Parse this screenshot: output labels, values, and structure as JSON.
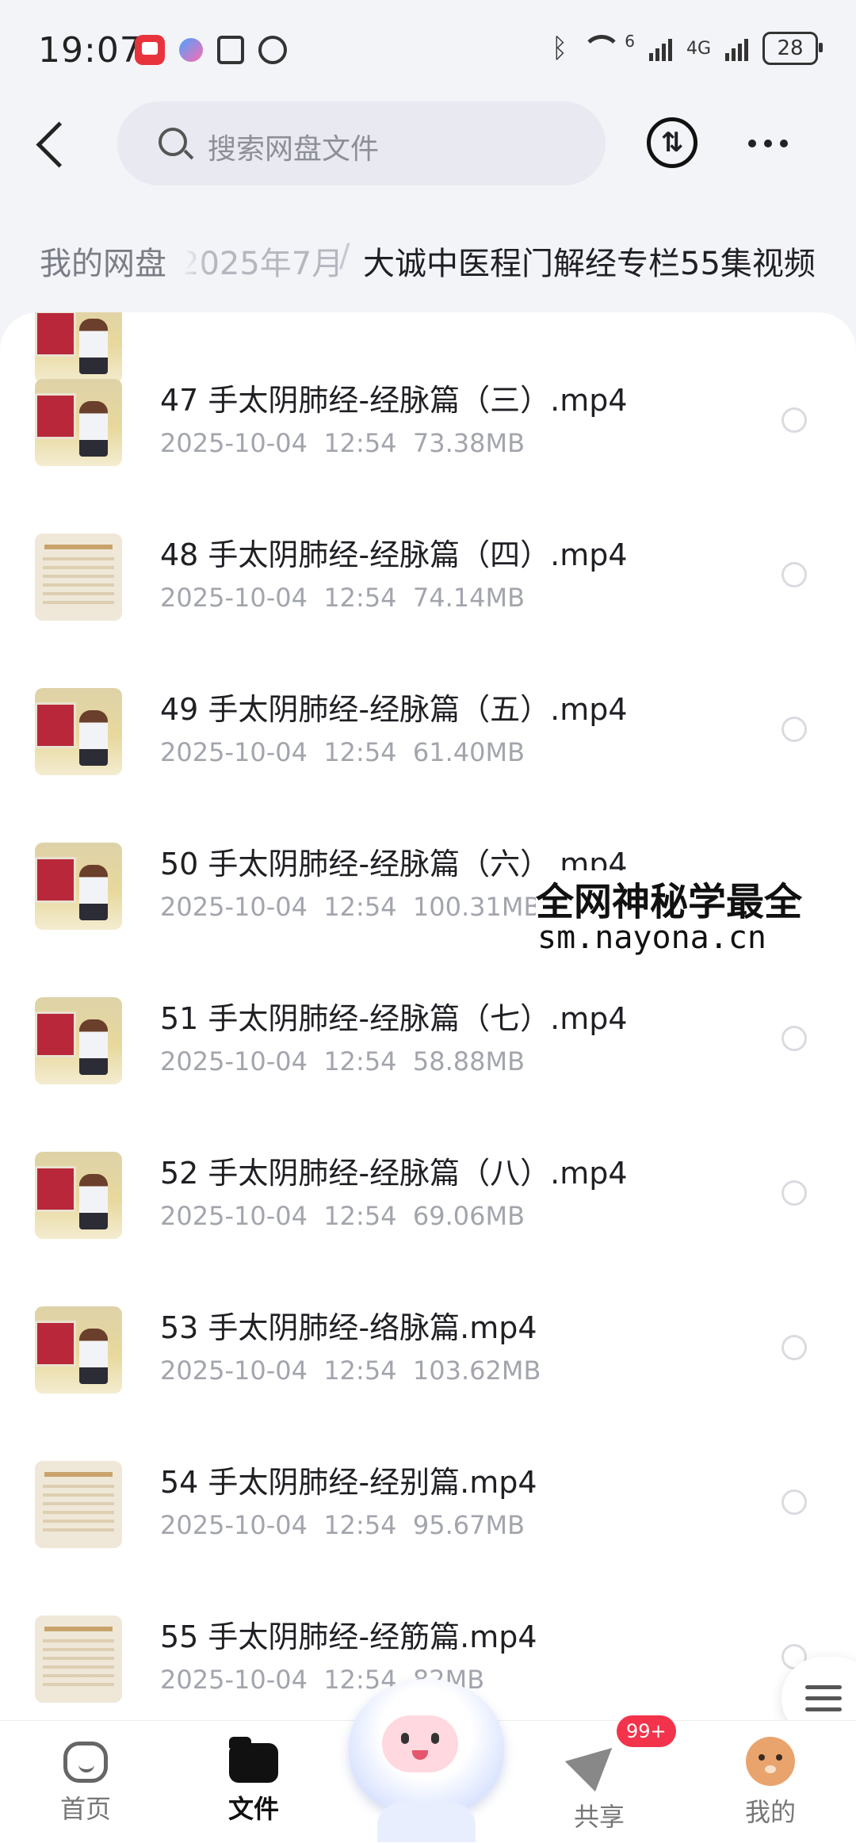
{
  "status_bar": {
    "time": "19:07",
    "network_sup": "6",
    "network_type": "4G",
    "battery": "28",
    "icons": [
      "red-app-icon",
      "cloud-icon",
      "nfc-icon",
      "alarm-icon",
      "bluetooth-icon",
      "wifi-icon",
      "signal-icon",
      "signal-icon",
      "battery-icon"
    ]
  },
  "header": {
    "search_placeholder": "搜索网盘文件",
    "icons": [
      "back-icon",
      "search-icon",
      "transfer-icon",
      "more-icon"
    ]
  },
  "breadcrumb": {
    "root": "我的网盘",
    "middle": "2025年7月",
    "separator": "/",
    "current": "大诚中医程门解经专栏55集视频"
  },
  "files": [
    {
      "name": "47 手太阴肺经-经脉篇（三）.mp4",
      "date": "2025-10-04",
      "time": "12:54",
      "size": "73.38MB",
      "thumb": "video"
    },
    {
      "name": "48 手太阴肺经-经脉篇（四）.mp4",
      "date": "2025-10-04",
      "time": "12:54",
      "size": "74.14MB",
      "thumb": "doc"
    },
    {
      "name": "49 手太阴肺经-经脉篇（五）.mp4",
      "date": "2025-10-04",
      "time": "12:54",
      "size": "61.40MB",
      "thumb": "video"
    },
    {
      "name": "50 手太阴肺经-经脉篇（六）.mp4",
      "date": "2025-10-04",
      "time": "12:54",
      "size": "100.31MB",
      "thumb": "video"
    },
    {
      "name": "51 手太阴肺经-经脉篇（七）.mp4",
      "date": "2025-10-04",
      "time": "12:54",
      "size": "58.88MB",
      "thumb": "video"
    },
    {
      "name": "52 手太阴肺经-经脉篇（八）.mp4",
      "date": "2025-10-04",
      "time": "12:54",
      "size": "69.06MB",
      "thumb": "video"
    },
    {
      "name": "53 手太阴肺经-络脉篇.mp4",
      "date": "2025-10-04",
      "time": "12:54",
      "size": "103.62MB",
      "thumb": "video"
    },
    {
      "name": "54 手太阴肺经-经别篇.mp4",
      "date": "2025-10-04",
      "time": "12:54",
      "size": "95.67MB",
      "thumb": "doc"
    },
    {
      "name": "55 手太阴肺经-经筋篇.mp4",
      "date": "2025-10-04",
      "time": "12:54",
      "size": "82MB",
      "thumb": "doc"
    }
  ],
  "watermark": {
    "line1": "全网神秘学最全",
    "line2": "sm.nayona.cn"
  },
  "bottom_nav": {
    "items": [
      {
        "label": "首页",
        "icon": "home-icon"
      },
      {
        "label": "文件",
        "icon": "files-icon",
        "active": true
      },
      {
        "label": "",
        "icon": "mascot-icon"
      },
      {
        "label": "共享",
        "icon": "share-icon",
        "badge": "99+"
      },
      {
        "label": "我的",
        "icon": "avatar-icon"
      }
    ]
  },
  "colors": {
    "accent_badge": "#f2334b",
    "background": "#f3f4f8",
    "panel": "#ffffff",
    "meta_text": "#a3a5ad"
  }
}
